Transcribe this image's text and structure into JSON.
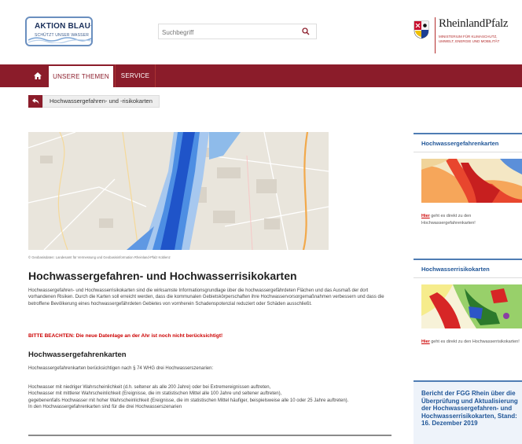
{
  "header": {
    "logo_aktion": {
      "title": "AKTION BLAU+",
      "subtitle": "SCHÜTZT UNSER WASSER"
    },
    "search": {
      "placeholder": "Suchbegriff",
      "icon": "search-icon"
    },
    "logo_rlp": {
      "name": "RheinlandPfalz",
      "ministry": "MINISTERIUM FÜR KLIMASCHUTZ, UMWELT, ENERGIE UND MOBILITÄT"
    }
  },
  "nav": {
    "home_icon": "home-icon",
    "tabs": [
      {
        "label": "UNSERE THEMEN",
        "active": true
      },
      {
        "label": "SERVICE",
        "active": false
      }
    ]
  },
  "breadcrumb": {
    "back_icon": "back-arrow-icon",
    "label": "Hochwassergefahren- und -risikokarten"
  },
  "main": {
    "map_credit": "© Geobasisdaten: Landesamt für Vermessung und Geobasisinformation Rheinland-Pfalz Koblenz",
    "title": "Hochwassergefahren- und Hochwasserrisikokarten",
    "intro": "Hochwassergefahren- und Hochwasserrisikokarten sind die wirksamste Informationsgrundlage über die hochwassergefährdeten Flächen und das Ausmaß der dort vorhandenen Risiken. Durch die Karten soll erreicht werden, dass die kommunalen Gebietskörperschaften ihre Hochwasservorsorgemaßnahmen verbessern und dass die betroffene Bevölkerung eines hochwassergefährdeten Gebietes von vornherein Schadenspotenzial reduziert oder Schäden ausschließt.",
    "warning": "BITTE BEACHTEN: Die neue Datenlage an der Ahr ist noch nicht berücksichtigt!",
    "subtitle": "Hochwassergefahrenkarten",
    "sub_intro": "Hochwassergefahrenkarten berücksichtigen nach § 74 WHG drei Hochwasserszenarien:",
    "scenario_1": "Hochwasser mit niedriger Wahrscheinlichkeit (d.h. seltener als alle 200 Jahre) oder bei Extremereignissen auftreten,",
    "scenario_2": "Hochwasser mit mittlerer Wahrscheinlichkeit (Ereignisse, die im statistischen Mittel alle 100 Jahre und seltener auftreten),",
    "scenario_3": "gegebenenfalls Hochwasser mit hoher Wahrscheinlichkeit (Ereignisse, die im statistischen Mittel häufiger, beispielsweise alle 10 oder 25 Jahre auftreten).",
    "scenario_footer": "In den Hochwassergefahrenkarten sind für die drei Hochwasserszenarien"
  },
  "sidebar": {
    "box1": {
      "title": "Hochwassergefahrenkarten",
      "link_word": "Hier",
      "link_text": " geht es direkt zu den Hochwassergefahrenkarten!"
    },
    "box2": {
      "title": "Hochwasserrisikokarten",
      "link_word": "Hier",
      "link_text": " geht es direkt zu den Hochwasserrisikokarten!"
    },
    "box3": {
      "report": "Bericht der FGG Rhein über die Überprüfung und Aktualisierung der Hochwassergefahren- und Hochwasserrisikokarten, Stand: 16. Dezember 2019"
    }
  },
  "colors": {
    "brand_red": "#8b1c2a",
    "link_blue": "#1f5597",
    "warning_red": "#cc0000"
  }
}
